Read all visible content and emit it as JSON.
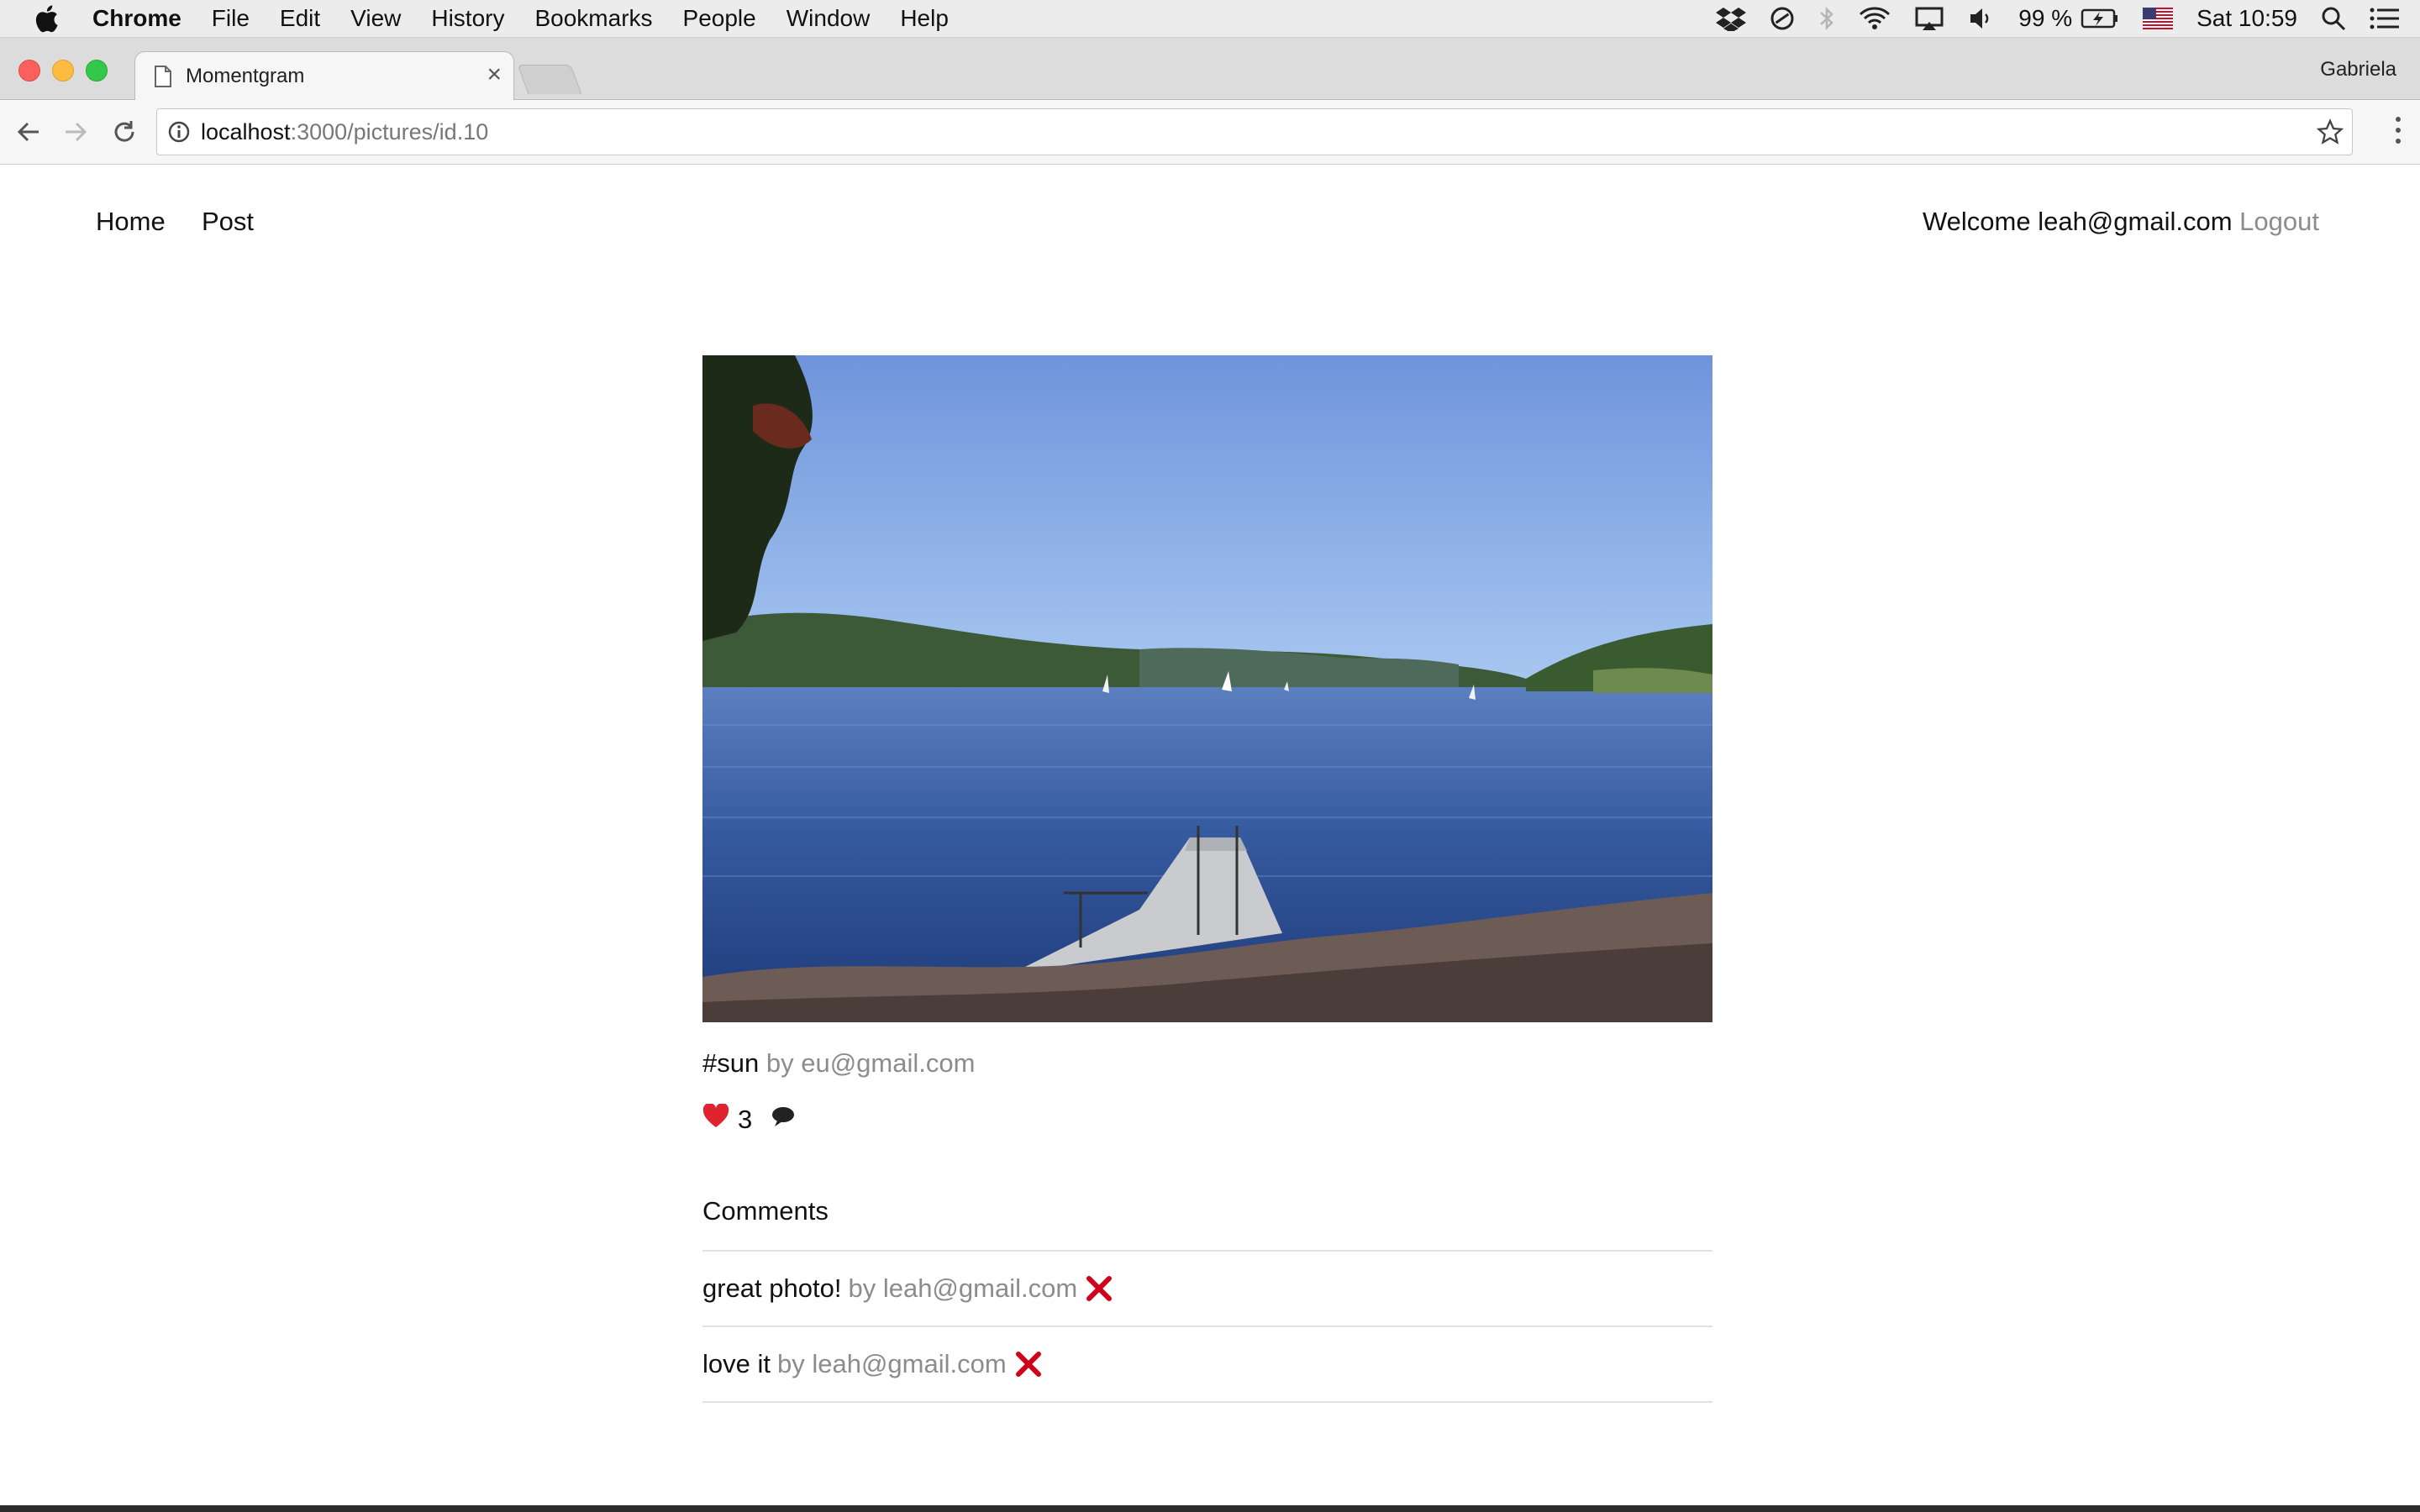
{
  "menubar": {
    "items": [
      "Chrome",
      "File",
      "Edit",
      "View",
      "History",
      "Bookmarks",
      "People",
      "Window",
      "Help"
    ],
    "battery": "99 %",
    "clock": "Sat 10:59"
  },
  "browser": {
    "tab_title": "Momentgram",
    "profile": "Gabriela",
    "url_host": "localhost",
    "url_path": ":3000/pictures/id.10"
  },
  "site": {
    "nav_home": "Home",
    "nav_post": "Post",
    "welcome": "Welcome leah@gmail.com",
    "logout": "Logout"
  },
  "picture": {
    "hashtag": "#sun",
    "author": "by eu@gmail.com",
    "likes": "3"
  },
  "comments_heading": "Comments",
  "comments": [
    {
      "text": "great photo!",
      "author": "by leah@gmail.com"
    },
    {
      "text": "love it",
      "author": "by leah@gmail.com"
    }
  ],
  "colors": {
    "accent_delete": "#d0021b",
    "muted_text": "#8c8c8c",
    "heart": "#e0242f"
  }
}
